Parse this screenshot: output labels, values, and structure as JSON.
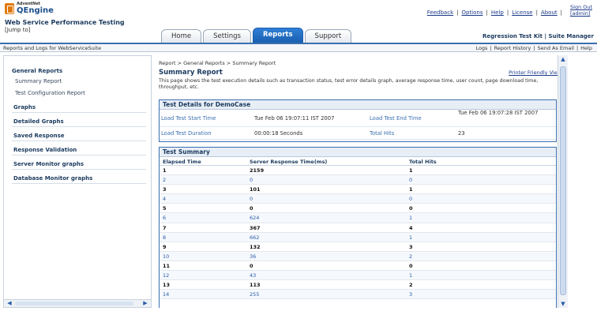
{
  "header": {
    "brand_top": "AdventNet",
    "brand": "QEngine",
    "app_title": "Web Service Performance Testing",
    "jump_to": "[Jump to]",
    "links": [
      "Feedback",
      "Options",
      "Help",
      "License",
      "About"
    ],
    "signout": "Sign Out",
    "signout_user": "[admin]",
    "suite_links": "Regression Test Kit | Suite Manager"
  },
  "tabs": [
    {
      "label": "Home",
      "active": false
    },
    {
      "label": "Settings",
      "active": false
    },
    {
      "label": "Reports",
      "active": true
    },
    {
      "label": "Support",
      "active": false
    }
  ],
  "subbar": {
    "left": "Reports and Logs for WebServiceSuite",
    "right": [
      "Logs",
      "Report History",
      "Send As Email",
      "Help"
    ]
  },
  "sidebar": {
    "general_reports": {
      "title": "General Reports",
      "items": [
        "Summary Report",
        "Test Configuration Report"
      ]
    },
    "sections": [
      "Graphs",
      "Detailed Graphs",
      "Saved Response",
      "Response Validation",
      "Server Monitor graphs",
      "Database Monitor graphs"
    ]
  },
  "main": {
    "breadcrumb": "Report > General Reports > Summary Report",
    "title": "Summary Report",
    "printer_link": "Printer Friendly View",
    "description": "This page shows the test execution details such as transaction status, test error details graph, average response time, user count, page download time, throughput, etc."
  },
  "test_details": {
    "title": "Test Details for DemoCase",
    "rows": [
      {
        "label1": "Load Test Start Time",
        "value1": "Tue Feb 06 19:07:11 IST 2007",
        "label2": "Load Test End Time",
        "value2": "Tue Feb 06 19:07:28 IST 2007"
      },
      {
        "label1": "Load Test Duration",
        "value1": "00:00:18 Seconds",
        "label2": "Total Hits",
        "value2": "23"
      }
    ]
  },
  "test_summary": {
    "title": "Test Summary",
    "columns": [
      "Elapsed Time",
      "Server Response Time(ms)",
      "Total Hits"
    ],
    "rows": [
      [
        "1",
        "2159",
        "1"
      ],
      [
        "2",
        "0",
        "0"
      ],
      [
        "3",
        "101",
        "1"
      ],
      [
        "4",
        "0",
        "0"
      ],
      [
        "5",
        "0",
        "0"
      ],
      [
        "6",
        "624",
        "1"
      ],
      [
        "7",
        "367",
        "4"
      ],
      [
        "8",
        "662",
        "1"
      ],
      [
        "9",
        "132",
        "3"
      ],
      [
        "10",
        "36",
        "2"
      ],
      [
        "11",
        "0",
        "0"
      ],
      [
        "12",
        "43",
        "1"
      ],
      [
        "13",
        "113",
        "2"
      ],
      [
        "14",
        "255",
        "3"
      ]
    ]
  }
}
